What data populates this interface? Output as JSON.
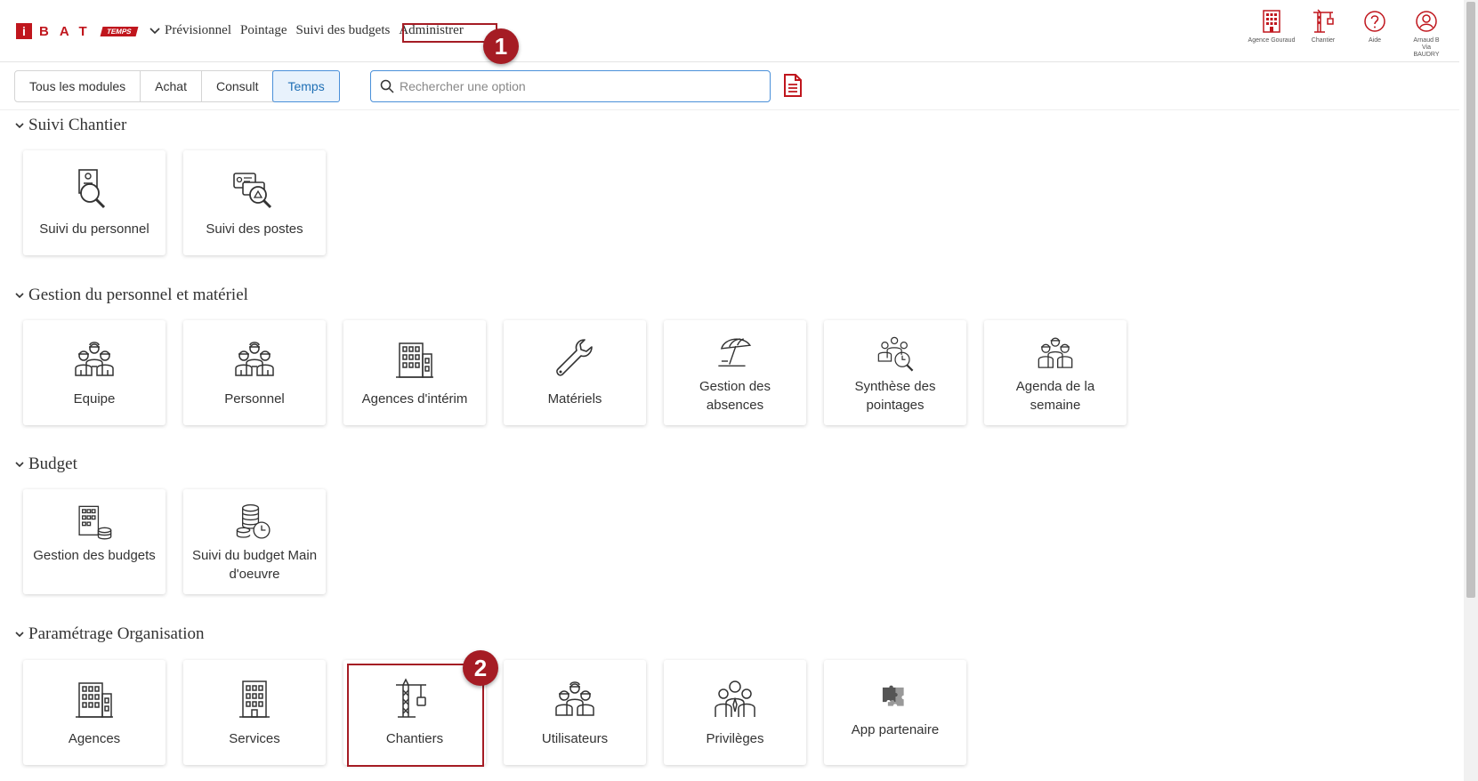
{
  "header": {
    "logo": {
      "i": "i",
      "bat": "BAT",
      "temps": "TEMPS"
    },
    "nav": [
      "Prévisionnel",
      "Pointage",
      "Suivi des budgets",
      "Administrer"
    ],
    "icons": [
      {
        "name": "building-icon",
        "label": "Agence Gouraud"
      },
      {
        "name": "crane-icon",
        "label": "Chantier"
      },
      {
        "name": "help-icon",
        "label": "Aide"
      },
      {
        "name": "user-icon",
        "label": "Arnaud B Via BAUDRY"
      }
    ]
  },
  "filter": {
    "tabs": [
      "Tous les modules",
      "Achat",
      "Consult",
      "Temps"
    ],
    "active_tab": "Temps",
    "search_placeholder": "Rechercher une option"
  },
  "annotations": {
    "badge1": "1",
    "badge2": "2"
  },
  "sections": [
    {
      "title": "Suivi Chantier",
      "cards": [
        {
          "label": "Suivi du personnel",
          "icon": "person-search-icon"
        },
        {
          "label": "Suivi des postes",
          "icon": "postes-search-icon"
        }
      ]
    },
    {
      "title": "Gestion du personnel et matériel",
      "cards": [
        {
          "label": "Equipe",
          "icon": "team-icon"
        },
        {
          "label": "Personnel",
          "icon": "staff-icon"
        },
        {
          "label": "Agences d'intérim",
          "icon": "building-icon"
        },
        {
          "label": "Matériels",
          "icon": "wrench-icon"
        },
        {
          "label": "Gestion des absences",
          "icon": "beach-umbrella-icon"
        },
        {
          "label": "Synthèse des pointages",
          "icon": "team-search-icon"
        },
        {
          "label": "Agenda de la semaine",
          "icon": "team-calendar-icon"
        }
      ]
    },
    {
      "title": "Budget",
      "cards": [
        {
          "label": "Gestion des budgets",
          "icon": "building-coins-icon"
        },
        {
          "label": "Suivi du budget Main d'oeuvre",
          "icon": "coins-clock-icon"
        }
      ]
    },
    {
      "title": "Paramétrage Organisation",
      "cards": [
        {
          "label": "Agences",
          "icon": "building-icon"
        },
        {
          "label": "Services",
          "icon": "building-icon"
        },
        {
          "label": "Chantiers",
          "icon": "crane-icon"
        },
        {
          "label": "Utilisateurs",
          "icon": "team-icon"
        },
        {
          "label": "Privilèges",
          "icon": "group-icon"
        },
        {
          "label": "App partenaire",
          "icon": "puzzle-icon"
        }
      ]
    }
  ],
  "colors": {
    "brand": "#c0161d",
    "annotation": "#a51c24",
    "active_tab": "#1f6fb5"
  }
}
